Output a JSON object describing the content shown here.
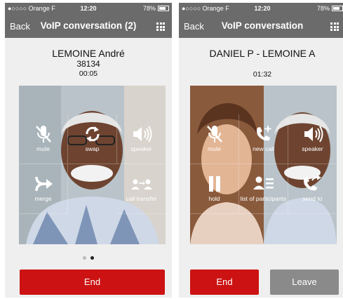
{
  "screens": [
    {
      "status": {
        "carrier": "●○○○○ Orange F",
        "time": "12:20",
        "battery": "78%"
      },
      "nav": {
        "back": "Back",
        "title": "VoIP conversation (2)"
      },
      "caller": {
        "name": "LEMOINE André",
        "number": "38134",
        "duration": "00:05"
      },
      "buttons": [
        {
          "label": "mute",
          "icon": "muted-mic-icon"
        },
        {
          "label": "swap",
          "icon": "swap-icon"
        },
        {
          "label": "speaker",
          "icon": "speaker-icon"
        },
        {
          "label": "merge",
          "icon": "merge-icon"
        },
        {
          "label": "call transfer",
          "icon": "call-transfer-icon"
        }
      ],
      "pager": {
        "pages": 2,
        "current": 2
      },
      "end_label": "End"
    },
    {
      "status": {
        "carrier": "●○○○○ Orange F",
        "time": "12:20",
        "battery": "78%"
      },
      "nav": {
        "back": "Back",
        "title": "VoIP conversation"
      },
      "caller": {
        "name": "DANIEL P - LEMOINE A",
        "duration": "01:32"
      },
      "buttons": [
        {
          "label": "mute",
          "icon": "muted-mic-icon"
        },
        {
          "label": "new call",
          "icon": "new-call-icon"
        },
        {
          "label": "speaker",
          "icon": "speaker-icon"
        },
        {
          "label": "hold",
          "icon": "pause-icon"
        },
        {
          "label": "list of participants",
          "icon": "participants-list-icon"
        },
        {
          "label": "send to",
          "icon": "send-to-icon"
        }
      ],
      "end_label": "End",
      "leave_label": "Leave"
    }
  ],
  "colors": {
    "navbar": "#6b6b6b",
    "end": "#cc1212",
    "leave": "#8a8a8a",
    "background": "#efefef"
  }
}
